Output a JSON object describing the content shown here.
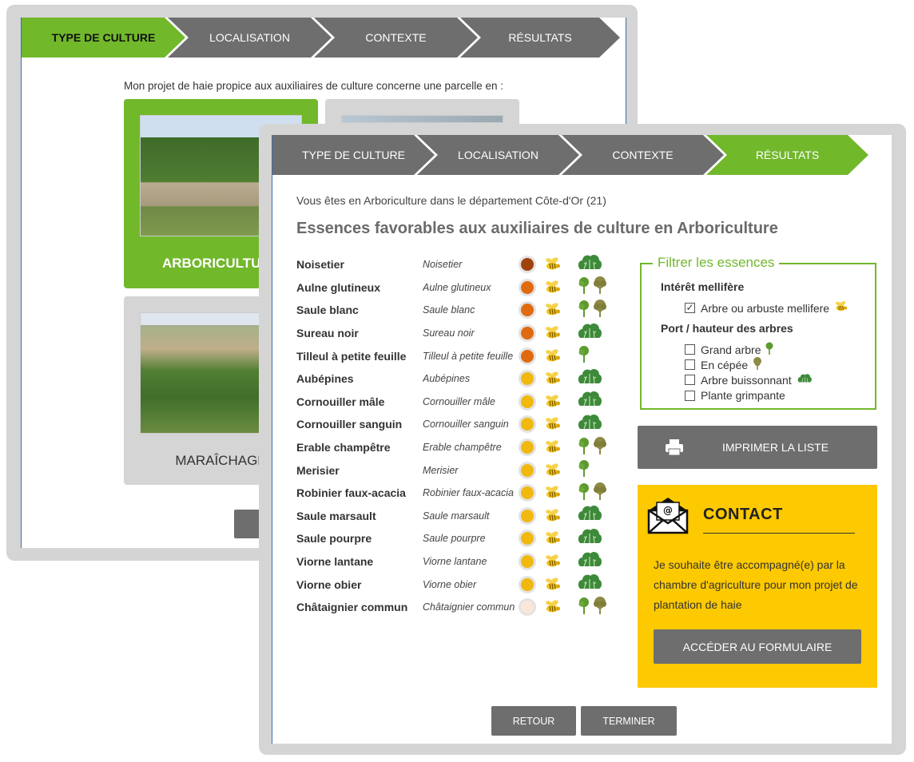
{
  "back_window": {
    "steps": [
      "TYPE DE CULTURE",
      "LOCALISATION",
      "CONTEXTE",
      "RÉSULTATS"
    ],
    "intro": "Mon projet de haie propice aux auxiliaires de culture concerne une parcelle en :",
    "tiles": {
      "arboriculture": "ARBORICULTURE",
      "maraichage": "MARAÎCHAGE"
    }
  },
  "front_window": {
    "steps": [
      "TYPE DE CULTURE",
      "LOCALISATION",
      "CONTEXTE",
      "RÉSULTATS"
    ],
    "intro": "Vous êtes en Arboriculture dans le département Côte-d'Or (21)",
    "title": "Essences favorables aux auxiliaires de culture en Arboriculture",
    "colors": {
      "accent_green": "#71b82b",
      "button_grey": "#6e6e6e",
      "contact_yellow": "#fdc900"
    },
    "plants": [
      {
        "name": "Noisetier",
        "latin": "Noisetier",
        "dot": "#a0420b",
        "icons": [
          "bush"
        ]
      },
      {
        "name": "Aulne glutineux",
        "latin": "Aulne glutineux",
        "dot": "#e06a10",
        "icons": [
          "tree",
          "cepee"
        ]
      },
      {
        "name": "Saule blanc",
        "latin": "Saule blanc",
        "dot": "#e06a10",
        "icons": [
          "tree",
          "cepee"
        ]
      },
      {
        "name": "Sureau noir",
        "latin": "Sureau noir",
        "dot": "#e06a10",
        "icons": [
          "bush"
        ]
      },
      {
        "name": "Tilleul à petite feuille",
        "latin": "Tilleul à petite feuille",
        "dot": "#e06a10",
        "icons": [
          "tree"
        ]
      },
      {
        "name": "Aubépines",
        "latin": "Aubépines",
        "dot": "#f1b80f",
        "icons": [
          "bush"
        ]
      },
      {
        "name": "Cornouiller mâle",
        "latin": "Cornouiller mâle",
        "dot": "#f1b80f",
        "icons": [
          "bush"
        ]
      },
      {
        "name": "Cornouiller sanguin",
        "latin": "Cornouiller sanguin",
        "dot": "#f1b80f",
        "icons": [
          "bush"
        ]
      },
      {
        "name": "Erable champêtre",
        "latin": "Erable champêtre",
        "dot": "#f1b80f",
        "icons": [
          "tree",
          "cepee"
        ]
      },
      {
        "name": "Merisier",
        "latin": "Merisier",
        "dot": "#f1b80f",
        "icons": [
          "tree"
        ]
      },
      {
        "name": "Robinier faux-acacia",
        "latin": "Robinier faux-acacia",
        "dot": "#f1b80f",
        "icons": [
          "tree",
          "cepee"
        ]
      },
      {
        "name": "Saule marsault",
        "latin": "Saule marsault",
        "dot": "#f1b80f",
        "icons": [
          "bush"
        ]
      },
      {
        "name": "Saule pourpre",
        "latin": "Saule pourpre",
        "dot": "#f1b80f",
        "icons": [
          "bush"
        ]
      },
      {
        "name": "Viorne lantane",
        "latin": "Viorne lantane",
        "dot": "#f1b80f",
        "icons": [
          "bush"
        ]
      },
      {
        "name": "Viorne obier",
        "latin": "Viorne obier",
        "dot": "#f1b80f",
        "icons": [
          "bush"
        ]
      },
      {
        "name": "Châtaignier commun",
        "latin": "Châtaignier commun",
        "dot": "#fbe6da",
        "icons": [
          "tree",
          "cepee"
        ]
      }
    ],
    "filter": {
      "legend": "Filtrer les essences",
      "group1": "Intérêt mellifère",
      "opt_mellifere": {
        "label": "Arbre ou arbuste mellifere",
        "checked": true
      },
      "group2": "Port / hauteur des arbres",
      "opt_grand_arbre": {
        "label": "Grand arbre",
        "checked": false
      },
      "opt_cepee": {
        "label": "En cépée",
        "checked": false
      },
      "opt_buissonnant": {
        "label": "Arbre buissonnant",
        "checked": false
      },
      "opt_grimpante": {
        "label": "Plante grimpante",
        "checked": false
      }
    },
    "print_button": "IMPRIMER LA LISTE",
    "contact": {
      "title": "CONTACT",
      "text": "Je souhaite être accompagné(e) par la chambre d'agriculture pour mon projet de plantation de haie",
      "button": "ACCÉDER AU FORMULAIRE"
    },
    "nav": {
      "back": "RETOUR",
      "finish": "TERMINER"
    }
  }
}
